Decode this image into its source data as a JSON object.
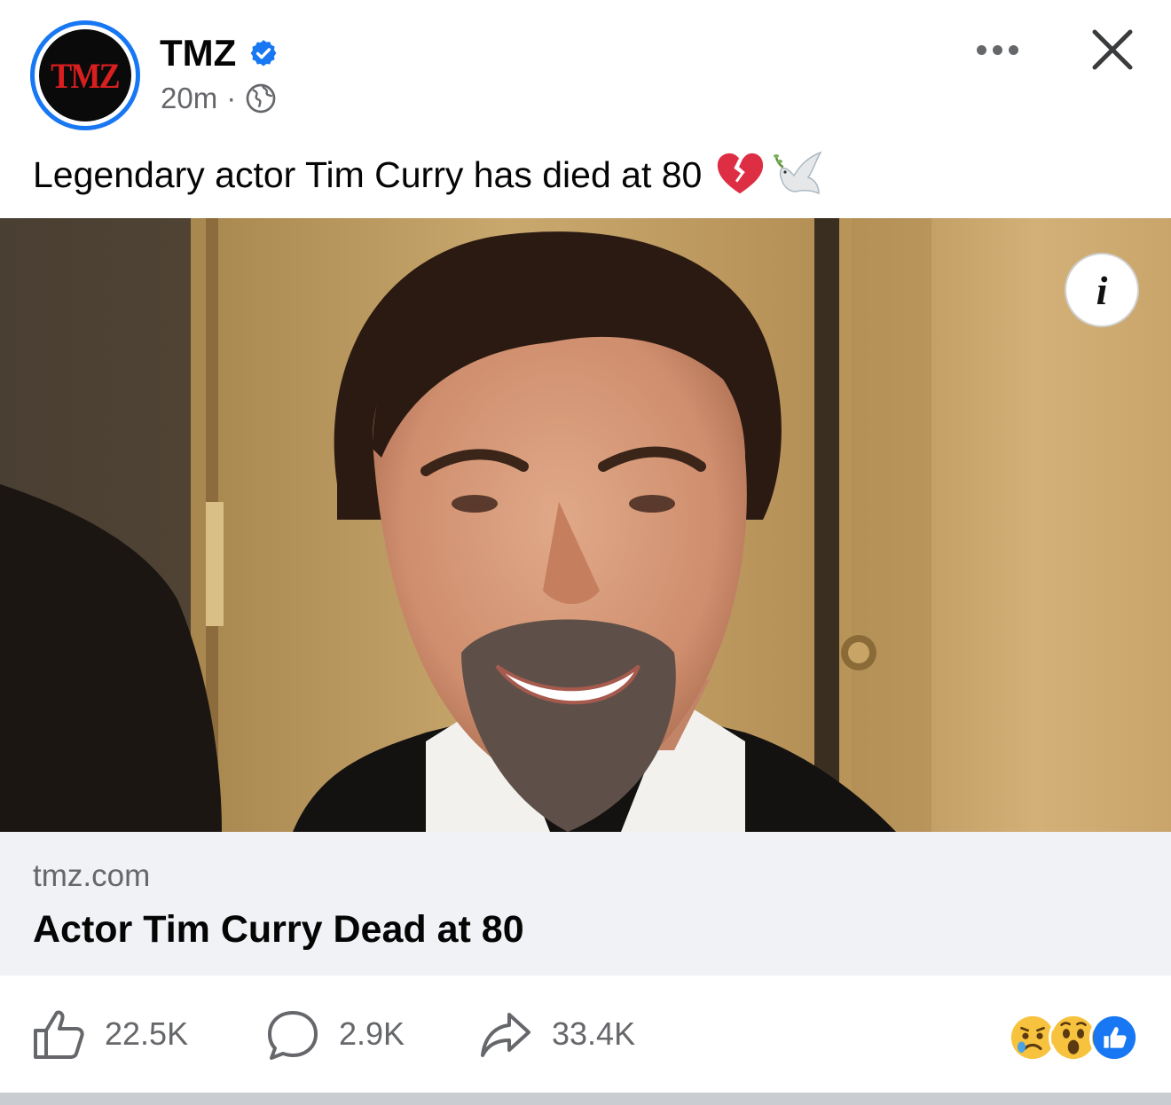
{
  "header": {
    "avatar_logo": "TMZ",
    "page_name": "TMZ",
    "verified": true,
    "timestamp": "20m",
    "separator": "·",
    "audience_icon": "globe-icon",
    "more_icon": "more-horizontal-icon",
    "close_icon": "close-icon"
  },
  "post": {
    "caption": "Legendary actor Tim Curry has died at 80",
    "caption_emojis": [
      "broken-heart-emoji",
      "dove-emoji"
    ],
    "photo_info_icon": "info-icon",
    "photo_info_glyph": "i"
  },
  "link_preview": {
    "domain": "tmz.com",
    "title": "Actor Tim Curry Dead at 80"
  },
  "actions": {
    "like_count": "22.5K",
    "comment_count": "2.9K",
    "share_count": "33.4K",
    "reactions": [
      "sad-reaction",
      "wow-reaction",
      "like-reaction"
    ]
  },
  "colors": {
    "verified_blue": "#1877f2",
    "secondary_text": "#65676b",
    "link_bg": "#f0f2f5",
    "tmz_red": "#d81f1f"
  }
}
